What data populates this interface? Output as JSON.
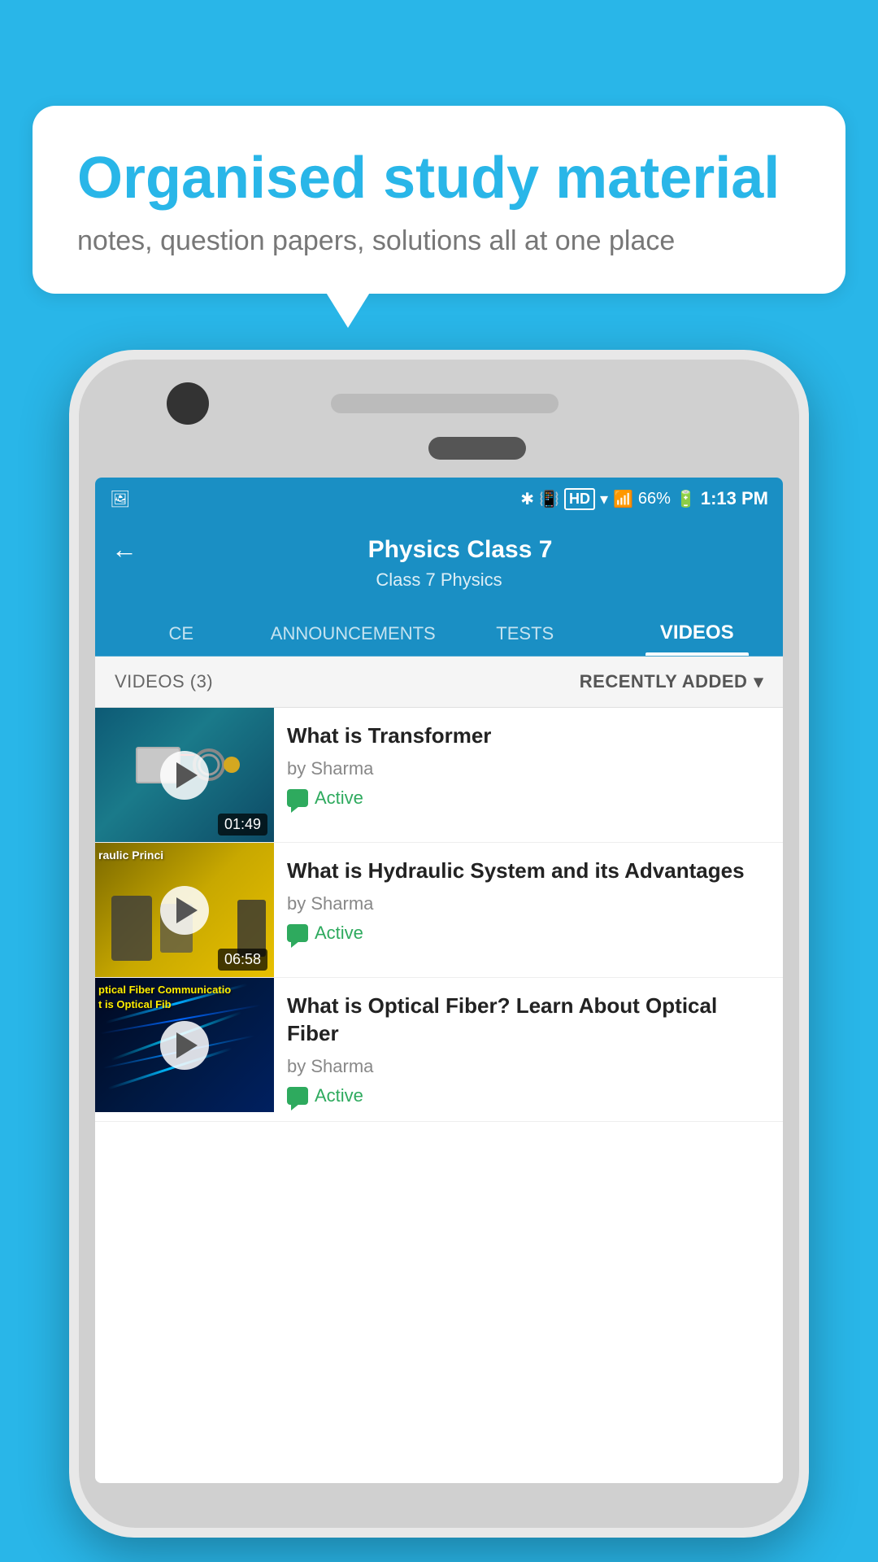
{
  "background_color": "#29b6e8",
  "speech_bubble": {
    "title": "Organised study material",
    "subtitle": "notes, question papers, solutions all at one place"
  },
  "status_bar": {
    "time": "1:13 PM",
    "battery": "66%",
    "signal": "HD"
  },
  "app_bar": {
    "title": "Physics Class 7",
    "breadcrumb": "Class 7    Physics",
    "back_label": "←"
  },
  "tabs": [
    {
      "label": "CE",
      "active": false
    },
    {
      "label": "ANNOUNCEMENTS",
      "active": false
    },
    {
      "label": "TESTS",
      "active": false
    },
    {
      "label": "VIDEOS",
      "active": true
    }
  ],
  "filter_bar": {
    "count": "VIDEOS (3)",
    "sort_label": "RECENTLY ADDED",
    "sort_arrow": "▾"
  },
  "videos": [
    {
      "title": "What is  Transformer",
      "author": "by Sharma",
      "status": "Active",
      "duration": "01:49",
      "thumb_type": "transformer"
    },
    {
      "title": "What is Hydraulic System and its Advantages",
      "author": "by Sharma",
      "status": "Active",
      "duration": "06:58",
      "thumb_type": "hydraulic",
      "thumb_text": "raulic Princi"
    },
    {
      "title": "What is Optical Fiber? Learn About Optical Fiber",
      "author": "by Sharma",
      "status": "Active",
      "duration": "",
      "thumb_type": "optical",
      "thumb_text_line1": "ptical Fiber Communicatio",
      "thumb_text_line2": "t is Optical Fib"
    }
  ]
}
